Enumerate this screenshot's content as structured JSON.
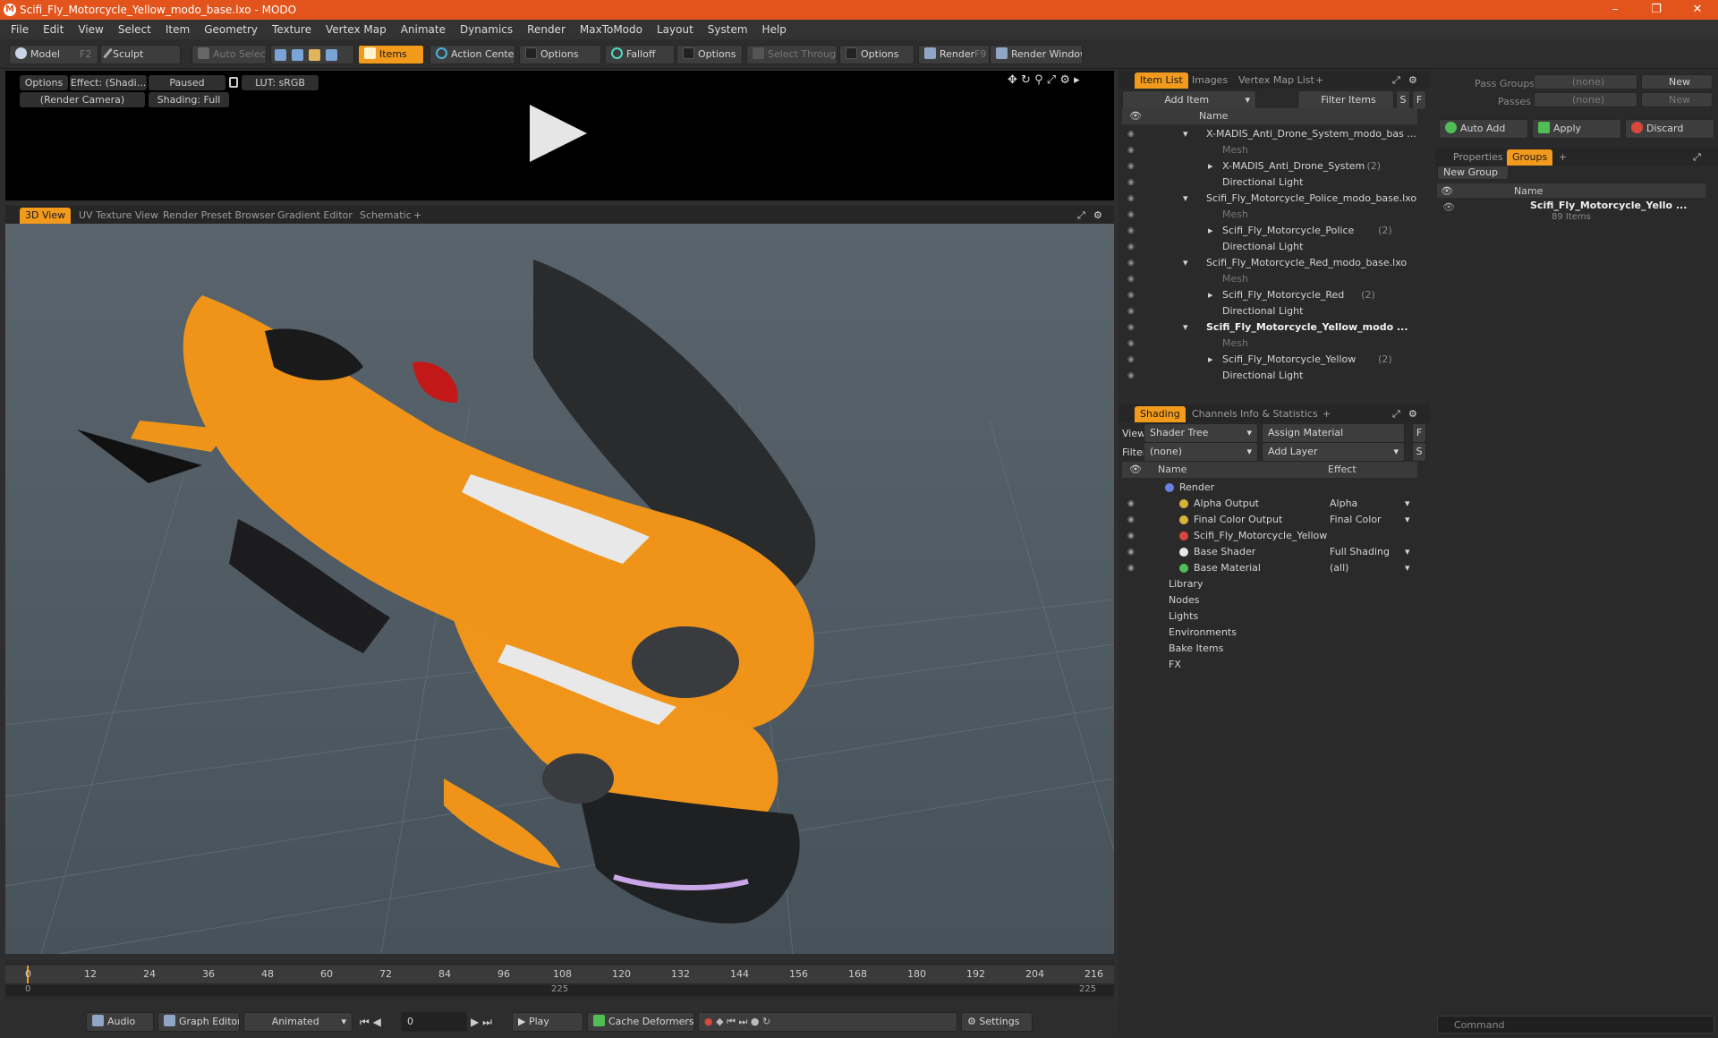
{
  "window": {
    "title": "Scifi_Fly_Motorcycle_Yellow_modo_base.lxo - MODO",
    "app_icon": "modo-logo-icon"
  },
  "menu": [
    "File",
    "Edit",
    "View",
    "Select",
    "Item",
    "Geometry",
    "Texture",
    "Vertex Map",
    "Animate",
    "Dynamics",
    "Render",
    "MaxToModo",
    "Layout",
    "System",
    "Help"
  ],
  "toolbar": {
    "model": "Model",
    "model_key": "F2",
    "sculpt": "Sculpt",
    "auto_select": "Auto Select",
    "items": "Items",
    "action_center": "Action Center",
    "options1": "Options",
    "falloff": "Falloff",
    "options2": "Options",
    "select_through": "Select Through",
    "options3": "Options",
    "render": "Render",
    "render_key": "F9",
    "render_window": "Render Window"
  },
  "preview": {
    "options": "Options",
    "effect": "Effect: (Shadi...",
    "paused": "Paused",
    "lut": "LUT: sRGB",
    "camera": "(Render Camera)",
    "shading": "Shading: Full"
  },
  "viewport_tabs": [
    "3D View",
    "UV Texture View",
    "Render Preset Browser",
    "Gradient Editor",
    "Schematic"
  ],
  "timeline": {
    "ticks": [
      "0",
      "12",
      "24",
      "36",
      "48",
      "60",
      "72",
      "84",
      "96",
      "108",
      "120",
      "132",
      "144",
      "156",
      "168",
      "180",
      "192",
      "204",
      "216"
    ],
    "start": "0",
    "mid": "225",
    "end": "225"
  },
  "bottom": {
    "audio": "Audio",
    "graph_editor": "Graph Editor",
    "animated": "Animated",
    "frame": "0",
    "play": "Play",
    "cache_deformers": "Cache Deformers",
    "settings": "Settings"
  },
  "item_list": {
    "tabs": [
      "Item List",
      "Images",
      "Vertex Map List"
    ],
    "add_item": "Add Item",
    "filter_items": "Filter Items",
    "s": "S",
    "f": "F",
    "name_header": "Name",
    "rows": [
      {
        "label": "X-MADIS_Anti_Drone_System_modo_bas ...",
        "count": "",
        "type": "scene",
        "indent": 0
      },
      {
        "label": "Mesh",
        "count": "",
        "type": "mesh",
        "indent": 1
      },
      {
        "label": "X-MADIS_Anti_Drone_System",
        "count": "(2)",
        "type": "group",
        "indent": 1
      },
      {
        "label": "Directional Light",
        "count": "",
        "type": "light",
        "indent": 1
      },
      {
        "label": "Scifi_Fly_Motorcycle_Police_modo_base.lxo",
        "count": "",
        "type": "scene",
        "indent": 0
      },
      {
        "label": "Mesh",
        "count": "",
        "type": "mesh",
        "indent": 1
      },
      {
        "label": "Scifi_Fly_Motorcycle_Police",
        "count": "(2)",
        "type": "group",
        "indent": 1
      },
      {
        "label": "Directional Light",
        "count": "",
        "type": "light",
        "indent": 1
      },
      {
        "label": "Scifi_Fly_Motorcycle_Red_modo_base.lxo",
        "count": "",
        "type": "scene",
        "indent": 0
      },
      {
        "label": "Mesh",
        "count": "",
        "type": "mesh",
        "indent": 1
      },
      {
        "label": "Scifi_Fly_Motorcycle_Red",
        "count": "(2)",
        "type": "group",
        "indent": 1
      },
      {
        "label": "Directional Light",
        "count": "",
        "type": "light",
        "indent": 1
      },
      {
        "label": "Scifi_Fly_Motorcycle_Yellow_modo ...",
        "count": "",
        "type": "scene-bold",
        "indent": 0
      },
      {
        "label": "Mesh",
        "count": "",
        "type": "mesh",
        "indent": 1
      },
      {
        "label": "Scifi_Fly_Motorcycle_Yellow",
        "count": "(2)",
        "type": "group",
        "indent": 1
      },
      {
        "label": "Directional Light",
        "count": "",
        "type": "light",
        "indent": 1
      }
    ]
  },
  "shading": {
    "tabs": [
      "Shading",
      "Channels",
      "Info & Statistics"
    ],
    "view_label": "View",
    "view_value": "Shader Tree",
    "assign_material": "Assign Material",
    "f": "F",
    "filter_label": "Filter",
    "filter_value": "(none)",
    "add_layer": "Add Layer",
    "s": "S",
    "name_header": "Name",
    "effect_header": "Effect",
    "rows": [
      {
        "label": "Render",
        "effect": "",
        "indent": 0,
        "dot": "#6d7fe0"
      },
      {
        "label": "Alpha Output",
        "effect": "Alpha",
        "indent": 1,
        "dot": "#d9b23a"
      },
      {
        "label": "Final Color Output",
        "effect": "Final Color",
        "indent": 1,
        "dot": "#d9b23a"
      },
      {
        "label": "Scifi_Fly_Motorcycle_Yellow",
        "effect": "",
        "indent": 1,
        "dot": "#d9473a"
      },
      {
        "label": "Base Shader",
        "effect": "Full Shading",
        "indent": 1,
        "dot": "#e6e6e6"
      },
      {
        "label": "Base Material",
        "effect": "(all)",
        "indent": 1,
        "dot": "#4fbf55"
      },
      {
        "label": "Library",
        "effect": "",
        "indent": 0,
        "dot": ""
      },
      {
        "label": "Nodes",
        "effect": "",
        "indent": 0,
        "dot": ""
      },
      {
        "label": "Lights",
        "effect": "",
        "indent": 0,
        "dot": ""
      },
      {
        "label": "Environments",
        "effect": "",
        "indent": 0,
        "dot": ""
      },
      {
        "label": "Bake Items",
        "effect": "",
        "indent": 0,
        "dot": ""
      },
      {
        "label": "FX",
        "effect": "",
        "indent": 0,
        "dot": ""
      }
    ]
  },
  "passes": {
    "pass_groups_label": "Pass Groups",
    "pass_groups_value": "(none)",
    "new1": "New",
    "passes_label": "Passes",
    "passes_value": "(none)",
    "new2": "New",
    "auto_add": "Auto Add",
    "apply": "Apply",
    "discard": "Discard"
  },
  "groups": {
    "tabs": [
      "Properties",
      "Groups"
    ],
    "new_group": "New Group",
    "name_header": "Name",
    "group_name": "Scifi_Fly_Motorcycle_Yello ...",
    "group_count": "89 Items"
  },
  "command": {
    "placeholder": "Command"
  },
  "colors": {
    "accent": "#f19a1c",
    "title_bar": "#e2541c"
  }
}
